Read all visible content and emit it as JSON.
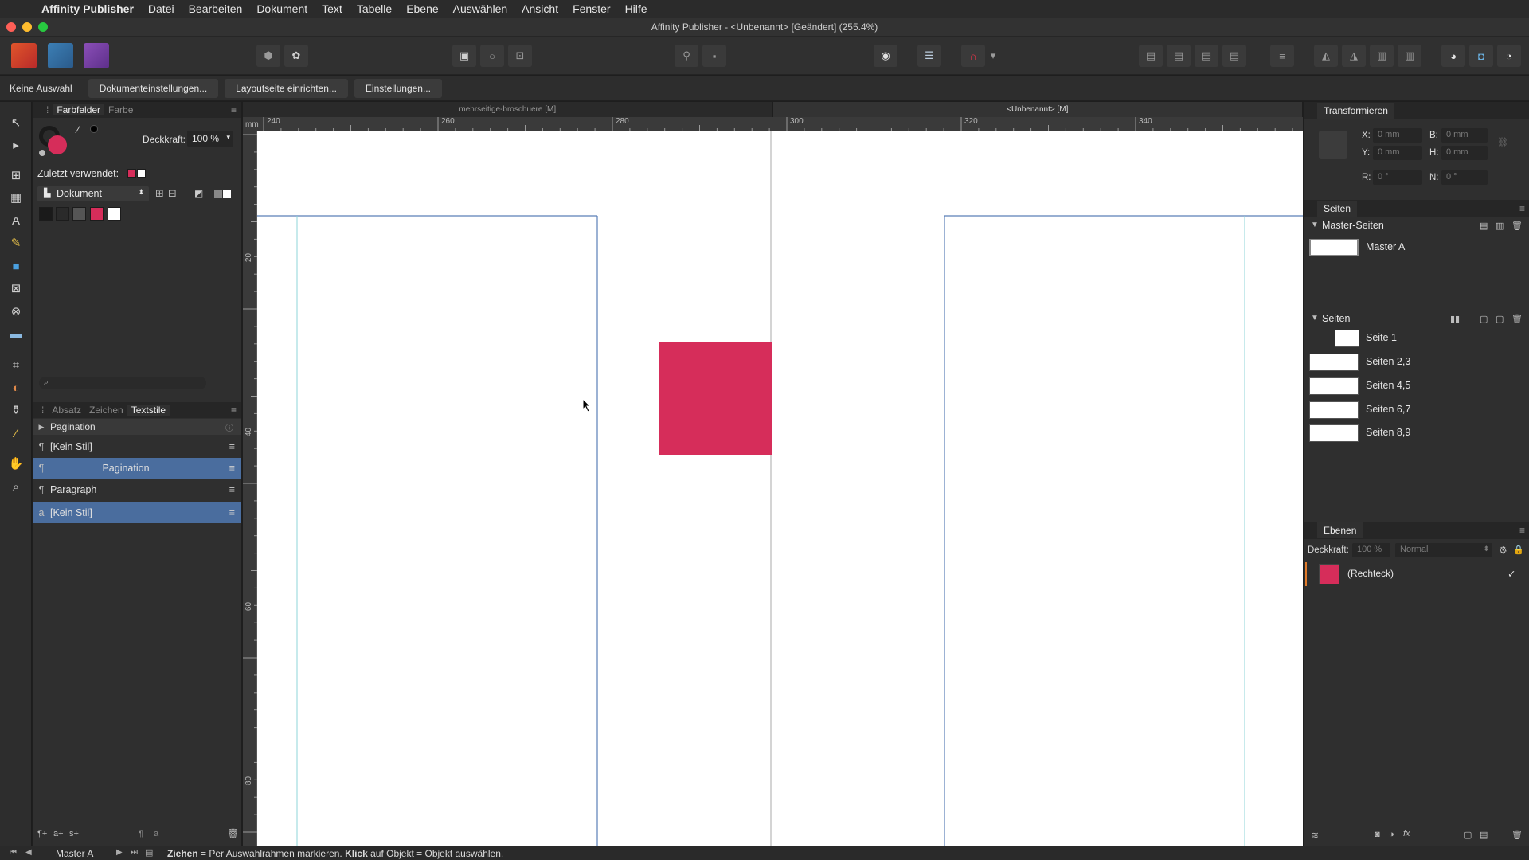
{
  "menubar": {
    "app_name": "Affinity Publisher",
    "items": [
      "Datei",
      "Bearbeiten",
      "Dokument",
      "Text",
      "Tabelle",
      "Ebene",
      "Auswählen",
      "Ansicht",
      "Fenster",
      "Hilfe"
    ]
  },
  "window": {
    "title": "Affinity Publisher - <Unbenannt> [Geändert] (255.4%)"
  },
  "context_bar": {
    "selection_label": "Keine Auswahl",
    "buttons": [
      "Dokumenteinstellungen...",
      "Layoutseite einrichten...",
      "Einstellungen..."
    ]
  },
  "swatches_panel": {
    "tabs": [
      "Farbfelder",
      "Farbe"
    ],
    "opacity_label": "Deckkraft:",
    "opacity_value": "100 %",
    "recent_label": "Zuletzt verwendet:",
    "palette_select": "Dokument",
    "colors": {
      "accent_red": "#d62d5a",
      "selection_blue": "#4a6d9e"
    }
  },
  "styles_panel": {
    "tabs": [
      "Absatz",
      "Zeichen",
      "Textstile"
    ],
    "group_label": "Pagination",
    "rows": [
      {
        "label": "[Kein Stil]",
        "selected": false,
        "centered": false
      },
      {
        "label": "Pagination",
        "selected": true,
        "centered": true
      },
      {
        "label": "Paragraph",
        "selected": false,
        "centered": false
      },
      {
        "label": "[Kein Stil]",
        "selected": true,
        "centered": false
      }
    ]
  },
  "document_tabs": [
    "mehrseitige-broschuere [M]",
    "<Unbenannt> [M]"
  ],
  "ruler": {
    "unit": "mm",
    "h_labels": [
      "240",
      "260",
      "280",
      "300",
      "320",
      "340"
    ],
    "v_labels": [
      "20",
      "40",
      "60",
      "80"
    ]
  },
  "transform_panel": {
    "title": "Transformieren",
    "fields": {
      "x_label": "X:",
      "x_value": "0 mm",
      "y_label": "Y:",
      "y_value": "0 mm",
      "b_label": "B:",
      "b_value": "0 mm",
      "h_label": "H:",
      "h_value": "0 mm",
      "r_label": "R:",
      "r_value": "0 °",
      "n_label": "N:",
      "n_value": "0 °"
    }
  },
  "pages_panel": {
    "title": "Seiten",
    "master_section": "Master-Seiten",
    "masters": [
      "Master A"
    ],
    "pages_section": "Seiten",
    "pages": [
      "Seite 1",
      "Seiten 2,3",
      "Seiten 4,5",
      "Seiten 6,7",
      "Seiten 8,9"
    ]
  },
  "layers_panel": {
    "title": "Ebenen",
    "opacity_label": "Deckkraft:",
    "opacity_value": "100 %",
    "blend_mode": "Normal",
    "layers": [
      {
        "name": "(Rechteck)",
        "visible_check": "✓"
      }
    ]
  },
  "status_bar": {
    "master": "Master A",
    "hint_bold_1": "Ziehen",
    "hint_1": " = Per Auswahlrahmen markieren. ",
    "hint_bold_2": "Klick",
    "hint_2": " auf Objekt = Objekt auswählen."
  }
}
